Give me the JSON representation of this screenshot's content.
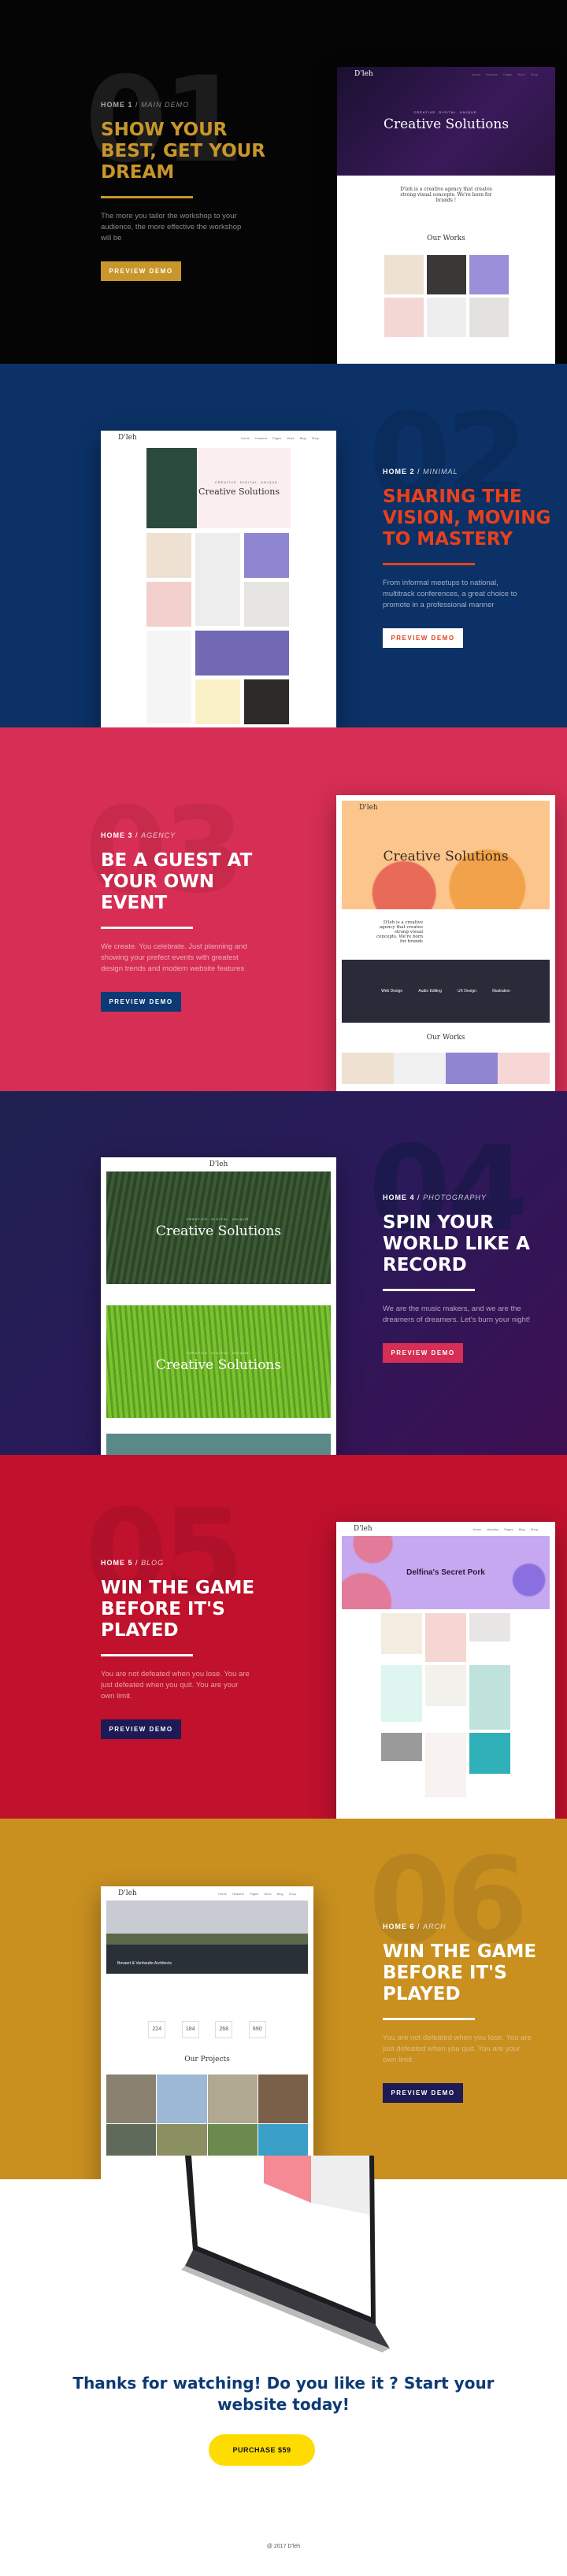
{
  "brand": "D'leh",
  "colors": {
    "gold": "#c8962a",
    "navy": "#0d3a75",
    "red_orange": "#e8401c",
    "pink": "#d62e54",
    "crimson": "#c0112d",
    "mustard": "#c99020",
    "indigo": "#1d1a55",
    "yellow": "#ffdc00"
  },
  "sections": [
    {
      "number": "01",
      "home": "HOME 1",
      "slash": "/",
      "style": "MAIN DEMO",
      "title": "SHOW YOUR BEST, GET YOUR DREAM",
      "text": "The more you tailor the workshop to your audience, the more effective the workshop will be",
      "button": "PREVIEW DEMO",
      "mock": {
        "hero_sub": "CREATIVE. DIGITAL. UNIQUE.",
        "hero_title": "Creative Solutions",
        "intro": "D'leh is a creative agency that creates strong visual concepts. We're born for brands !",
        "works": "Our Works"
      }
    },
    {
      "number": "02",
      "home": "HOME 2",
      "slash": "/",
      "style": "MINIMAL",
      "title": "SHARING THE VISION, MOVING TO MASTERY",
      "text": "From informal meetups to national, multitrack conferences, a great choice to promote in a professional manner",
      "button": "PREVIEW DEMO",
      "mock": {
        "hero_sub": "CREATIVE. DIGITAL. UNIQUE.",
        "hero_title": "Creative Solutions"
      }
    },
    {
      "number": "03",
      "home": "HOME 3",
      "slash": "/",
      "style": "AGENCY",
      "title": "BE A GUEST AT YOUR OWN EVENT",
      "text": "We create. You celebrate. Just planning and showing your prefect events with greatest design trends and modern website features",
      "button": "PREVIEW DEMO",
      "mock": {
        "hero_title": "Creative Solutions",
        "quote": "D'leh is a creative agency that creates strong visual concepts. We're born for brands",
        "services": [
          "Web Design",
          "Audio Editing",
          "UX Design",
          "Illustration"
        ],
        "works": "Our Works"
      }
    },
    {
      "number": "04",
      "home": "HOME 4",
      "slash": "/",
      "style": "PHOTOGRAPHY",
      "title": "SPIN YOUR WORLD LIKE A RECORD",
      "text": "We are the music makers, and we are the dreamers of dreamers. Let's burn your night!",
      "button": "PREVIEW DEMO",
      "mock": {
        "hero_sub": "CREATIVE. DIGITAL. UNIQUE.",
        "hero_title": "Creative Solutions"
      }
    },
    {
      "number": "05",
      "home": "HOME 5",
      "slash": "/",
      "style": "BLOG",
      "title": "WIN THE GAME BEFORE IT'S PLAYED",
      "text": "You are not defeated when you lose. You are just defeated when you quit. You are your own limit.",
      "button": "PREVIEW DEMO",
      "mock": {
        "hero_title": "Delfina's Secret Pork"
      }
    },
    {
      "number": "06",
      "home": "HOME 6",
      "slash": "/",
      "style": "ARCH",
      "title": "WIN THE GAME BEFORE IT'S PLAYED",
      "text": "You are not defeated when you lose. You are just defeated when you quit. You are your own limit.",
      "button": "PREVIEW DEMO",
      "mock": {
        "hero_caption": "Bovaert & Vanhoutte Architects",
        "stats": [
          "224",
          "184",
          "268",
          "690"
        ],
        "projects": "Our Projects"
      }
    }
  ],
  "footer": {
    "headline": "Thanks for watching! Do you like it ? Start your website today!",
    "purchase": "PURCHASE $59",
    "copyright": "@ 2017 D'leh"
  }
}
